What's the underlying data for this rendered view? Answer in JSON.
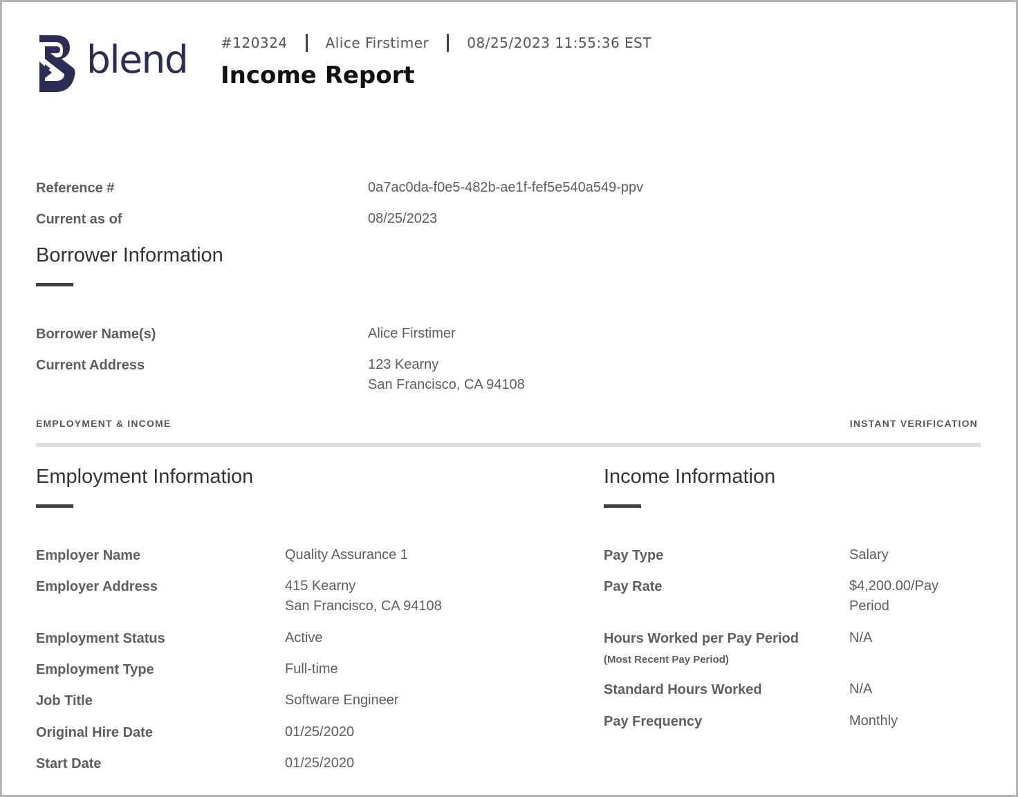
{
  "brand": {
    "name": "blend",
    "color": "#2b2d55",
    "logo_icon": "blend-b-logo-icon"
  },
  "header": {
    "report_number": "#120324",
    "borrower": "Alice Firstimer",
    "timestamp": "08/25/2023 11:55:36 EST",
    "title": "Income Report"
  },
  "summary": {
    "reference_label": "Reference #",
    "reference_value": "0a7ac0da-f0e5-482b-ae1f-fef5e540a549-ppv",
    "current_as_of_label": "Current as of",
    "current_as_of_value": "08/25/2023"
  },
  "borrower_section": {
    "heading": "Borrower Information",
    "name_label": "Borrower Name(s)",
    "name_value": "Alice Firstimer",
    "address_label": "Current Address",
    "address_line1": "123 Kearny",
    "address_line2": "San Francisco, CA 94108"
  },
  "section_bar": {
    "left": "EMPLOYMENT & INCOME",
    "right": "INSTANT VERIFICATION"
  },
  "employment": {
    "heading": "Employment Information",
    "employer_name_label": "Employer Name",
    "employer_name_value": "Quality Assurance 1",
    "employer_address_label": "Employer Address",
    "employer_address_line1": "415 Kearny",
    "employer_address_line2": "San Francisco, CA 94108",
    "status_label": "Employment Status",
    "status_value": "Active",
    "type_label": "Employment Type",
    "type_value": "Full-time",
    "job_title_label": "Job Title",
    "job_title_value": "Software Engineer",
    "original_hire_label": "Original Hire Date",
    "original_hire_value": "01/25/2020",
    "start_date_label": "Start Date",
    "start_date_value": "01/25/2020"
  },
  "income": {
    "heading": "Income Information",
    "pay_type_label": "Pay Type",
    "pay_type_value": "Salary",
    "pay_rate_label": "Pay Rate",
    "pay_rate_line1": "$4,200.00/Pay",
    "pay_rate_line2": "Period",
    "hours_label": "Hours Worked per Pay Period",
    "hours_sublabel": "(Most Recent Pay Period)",
    "hours_value": "N/A",
    "standard_hours_label": "Standard Hours Worked",
    "standard_hours_value": "N/A",
    "frequency_label": "Pay Frequency",
    "frequency_value": "Monthly"
  }
}
